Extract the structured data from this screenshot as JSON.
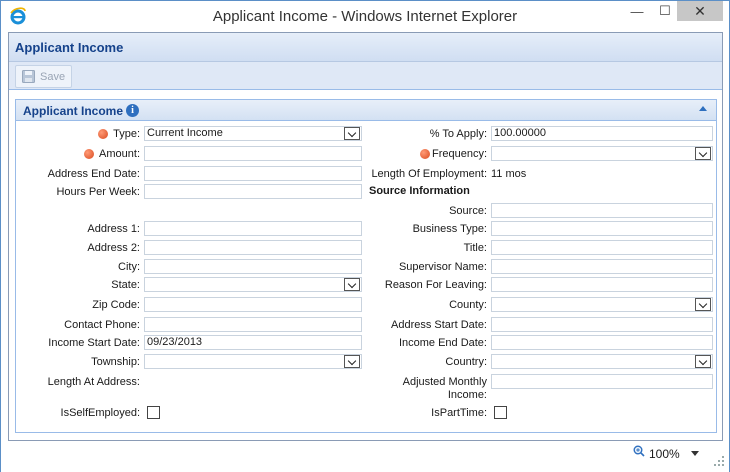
{
  "window": {
    "title": "Applicant Income - Windows Internet Explorer",
    "minimize": "—",
    "maximize": "☐",
    "close": "✕"
  },
  "page": {
    "title": "Applicant Income"
  },
  "toolbar": {
    "save_label": "Save"
  },
  "panel": {
    "title": "Applicant Income"
  },
  "left": {
    "type_label": "Type:",
    "type_value": "Current Income",
    "amount_label": "Amount:",
    "amount_value": "",
    "address_end_date_label": "Address End Date:",
    "address_end_date_value": "",
    "hours_per_week_label": "Hours Per Week:",
    "hours_per_week_value": "",
    "address1_label": "Address 1:",
    "address1_value": "",
    "address2_label": "Address 2:",
    "address2_value": "",
    "city_label": "City:",
    "city_value": "",
    "state_label": "State:",
    "state_value": "",
    "zip_label": "Zip Code:",
    "zip_value": "",
    "contact_phone_label": "Contact Phone:",
    "contact_phone_value": "",
    "income_start_date_label": "Income Start Date:",
    "income_start_date_value": "09/23/2013",
    "township_label": "Township:",
    "township_value": "",
    "length_at_address_label": "Length At Address:",
    "length_at_address_value": "",
    "is_self_employed_label": "IsSelfEmployed:"
  },
  "right": {
    "percent_to_apply_label": "% To Apply:",
    "percent_to_apply_value": "100.00000",
    "frequency_label": "Frequency:",
    "frequency_value": "",
    "length_of_employment_label": "Length Of Employment:",
    "length_of_employment_value": "11 mos",
    "source_information_heading": "Source Information",
    "source_label": "Source:",
    "source_value": "",
    "business_type_label": "Business Type:",
    "business_type_value": "",
    "title_label": "Title:",
    "title_value": "",
    "supervisor_name_label": "Supervisor Name:",
    "supervisor_name_value": "",
    "reason_for_leaving_label": "Reason For Leaving:",
    "reason_for_leaving_value": "",
    "county_label": "County:",
    "county_value": "",
    "address_start_date_label": "Address Start Date:",
    "address_start_date_value": "",
    "income_end_date_label": "Income End Date:",
    "income_end_date_value": "",
    "country_label": "Country:",
    "country_value": "",
    "adjusted_monthly_income_label": "Adjusted Monthly Income:",
    "adjusted_monthly_income_value": "",
    "is_part_time_label": "IsPartTime:"
  },
  "statusbar": {
    "zoom": "100%"
  },
  "icons": {
    "ie": "ie-logo-icon",
    "save": "floppy-disk-icon",
    "info": "info-icon",
    "collapse": "collapse-up-icon",
    "required": "required-marker-icon",
    "zoom": "zoom-magnifier-icon"
  },
  "colors": {
    "header_text": "#15428b",
    "panel_border": "#99bbe8",
    "required_marker": "#d94a1e"
  }
}
